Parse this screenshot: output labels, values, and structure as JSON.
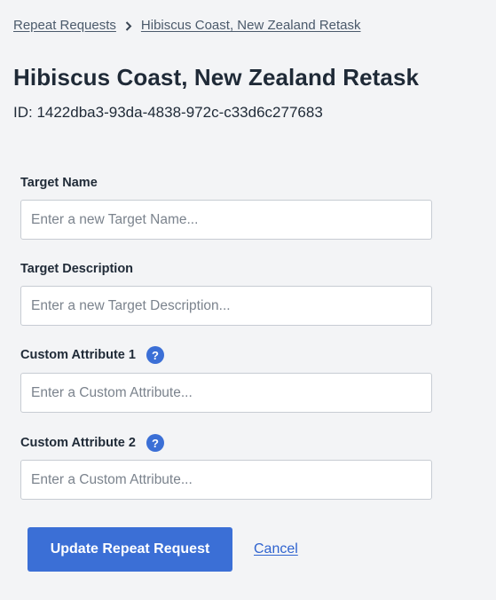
{
  "breadcrumb": {
    "items": [
      {
        "label": "Repeat Requests"
      },
      {
        "label": "Hibiscus Coast, New Zealand Retask"
      }
    ]
  },
  "header": {
    "title": "Hibiscus Coast, New Zealand Retask",
    "id_line": "ID: 1422dba3-93da-4838-972c-c33d6c277683"
  },
  "form": {
    "target_name": {
      "label": "Target Name",
      "value": "",
      "placeholder": "Enter a new Target Name..."
    },
    "target_description": {
      "label": "Target Description",
      "value": "",
      "placeholder": "Enter a new Target Description..."
    },
    "custom_attribute_1": {
      "label": "Custom Attribute 1",
      "value": "",
      "placeholder": "Enter a Custom Attribute...",
      "help": "?"
    },
    "custom_attribute_2": {
      "label": "Custom Attribute 2",
      "value": "",
      "placeholder": "Enter a Custom Attribute...",
      "help": "?"
    }
  },
  "actions": {
    "submit_label": "Update Repeat Request",
    "cancel_label": "Cancel"
  },
  "icons": {
    "breadcrumb_separator": "chevron-right-icon",
    "help": "question-circle-icon"
  },
  "colors": {
    "background": "#f3f4f6",
    "accent": "#3b6fd6",
    "link": "#2f63cf",
    "text": "#1f2a37"
  }
}
